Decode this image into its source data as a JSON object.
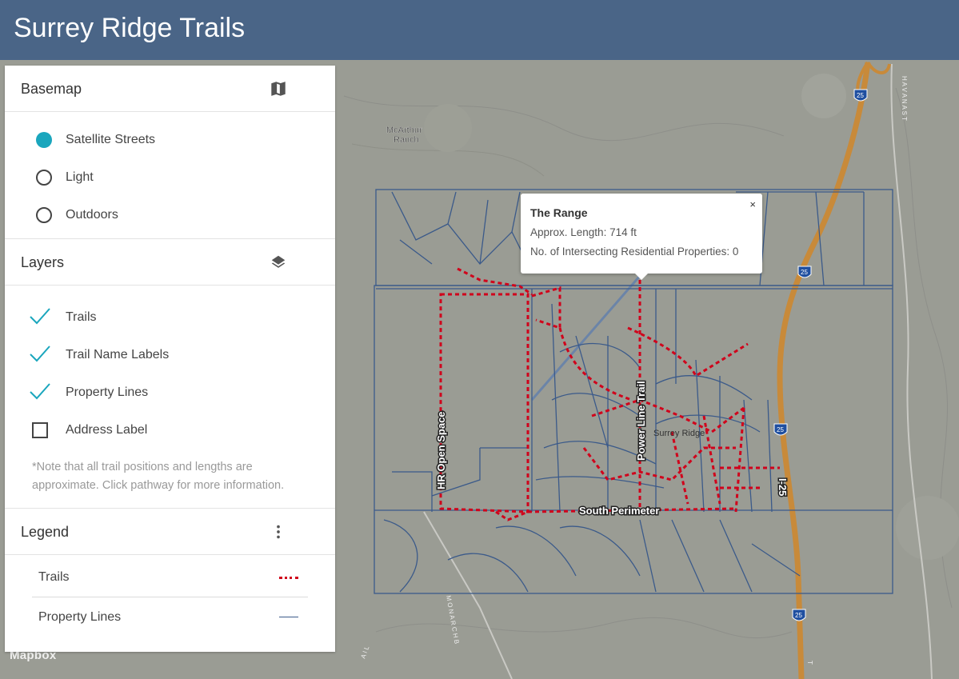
{
  "app": {
    "title": "Surrey Ridge Trails"
  },
  "basemap": {
    "title": "Basemap",
    "icon": "map-icon",
    "options": [
      {
        "label": "Satellite Streets",
        "selected": true
      },
      {
        "label": "Light",
        "selected": false
      },
      {
        "label": "Outdoors",
        "selected": false
      }
    ]
  },
  "layers": {
    "title": "Layers",
    "icon": "layers-icon",
    "items": [
      {
        "label": "Trails",
        "checked": true
      },
      {
        "label": "Trail Name Labels",
        "checked": true
      },
      {
        "label": "Property Lines",
        "checked": true
      },
      {
        "label": "Address Label",
        "checked": false
      }
    ],
    "note": "*Note that all trail positions and lengths are approximate. Click pathway for more information."
  },
  "legend": {
    "title": "Legend",
    "icon": "more-vertical-icon",
    "items": [
      {
        "label": "Trails",
        "swatch": "dotted-red",
        "color": "#d0021b"
      },
      {
        "label": "Property Lines",
        "swatch": "solid-blue",
        "color": "#3b5a8a"
      }
    ]
  },
  "popup": {
    "title": "The Range",
    "length": "Approx. Length: 714 ft",
    "properties": "No. of Intersecting Residential Properties: 0",
    "close": "×"
  },
  "map": {
    "place_labels": {
      "mcarthur_1": "McArthur",
      "mcarthur_2": "Ranch",
      "surrey": "Surrey Ridge",
      "havana": "H A V A N A  S T",
      "monarch": "M O N A R C H  B",
      "trail_s": "T",
      "trail_ail": "A I L"
    },
    "trail_labels": {
      "hr": "HR Open Space",
      "power": "Power Line Trail",
      "south": "South Perimeter"
    },
    "road_labels": {
      "i25": "I-25",
      "shield": "25"
    },
    "attribution": "Mapbox",
    "colors": {
      "trail": "#d0021b",
      "property": "#3b5a8a",
      "highway": "#c88a3a",
      "radio_on": "#1aa6bd",
      "check": "#1aa6bd"
    }
  }
}
